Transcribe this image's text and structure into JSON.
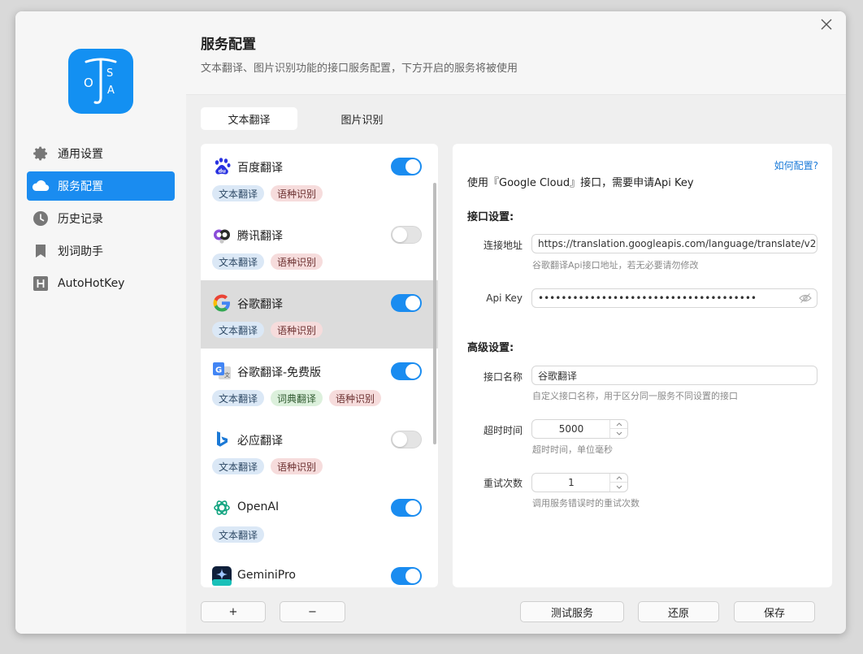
{
  "app": {
    "logo_alt": "OTSA"
  },
  "sidebar": {
    "items": [
      {
        "label": "通用设置",
        "icon": "gear-icon"
      },
      {
        "label": "服务配置",
        "icon": "cloud-icon"
      },
      {
        "label": "历史记录",
        "icon": "clock-icon"
      },
      {
        "label": "划词助手",
        "icon": "bookmark-icon"
      },
      {
        "label": "AutoHotKey",
        "icon": "h-letter-icon"
      }
    ]
  },
  "header": {
    "title": "服务配置",
    "subtitle": "文本翻译、图片识别功能的接口服务配置，下方开启的服务将被使用"
  },
  "tabs": [
    {
      "label": "文本翻译"
    },
    {
      "label": "图片识别"
    }
  ],
  "services": [
    {
      "name": "百度翻译",
      "enabled": true,
      "tags": [
        "文本翻译",
        "语种识别"
      ]
    },
    {
      "name": "腾讯翻译",
      "enabled": false,
      "tags": [
        "文本翻译",
        "语种识别"
      ]
    },
    {
      "name": "谷歌翻译",
      "enabled": true,
      "tags": [
        "文本翻译",
        "语种识别"
      ]
    },
    {
      "name": "谷歌翻译-免费版",
      "enabled": true,
      "tags": [
        "文本翻译",
        "词典翻译",
        "语种识别"
      ]
    },
    {
      "name": "必应翻译",
      "enabled": false,
      "tags": [
        "文本翻译",
        "语种识别"
      ]
    },
    {
      "name": "OpenAI",
      "enabled": true,
      "tags": [
        "文本翻译"
      ]
    },
    {
      "name": "GeminiPro",
      "enabled": true,
      "tags": []
    }
  ],
  "config": {
    "help_link": "如何配置?",
    "api_desc": "使用『Google Cloud』接口，需要申请Api Key",
    "interface_section": "接口设置:",
    "endpoint_label": "连接地址",
    "endpoint_value": "https://translation.googleapis.com/language/translate/v2",
    "endpoint_hint": "谷歌翻译Api接口地址，若无必要请勿修改",
    "apikey_label": "Api Key",
    "apikey_value": "••••••••••••••••••••••••••••••••••••••",
    "advanced_section": "高级设置:",
    "name_label": "接口名称",
    "name_value": "谷歌翻译",
    "name_hint": "自定义接口名称，用于区分同一服务不同设置的接口",
    "timeout_label": "超时时间",
    "timeout_value": "5000",
    "timeout_hint": "超时时间，单位毫秒",
    "retry_label": "重试次数",
    "retry_value": "1",
    "retry_hint": "调用服务错误时的重试次数"
  },
  "buttons": {
    "add": "+",
    "remove": "−",
    "test": "测试服务",
    "reset": "还原",
    "save": "保存"
  },
  "colors": {
    "accent": "#1a8cf0",
    "logo_bg": "#1390f2"
  }
}
